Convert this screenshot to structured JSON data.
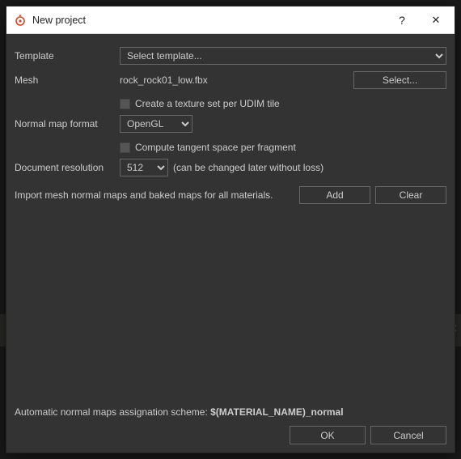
{
  "titlebar": {
    "title": "New project",
    "help_label": "?",
    "close_label": "✕"
  },
  "template": {
    "label": "Template",
    "selected": "Select template..."
  },
  "mesh": {
    "label": "Mesh",
    "filename": "rock_rock01_low.fbx",
    "select_button": "Select..."
  },
  "udim": {
    "label": "Create a texture set per UDIM tile"
  },
  "normal": {
    "label": "Normal map format",
    "selected": "OpenGL"
  },
  "tangent": {
    "label": "Compute tangent space per fragment"
  },
  "resolution": {
    "label": "Document resolution",
    "selected": "512",
    "note": "(can be changed later without loss)"
  },
  "import": {
    "text": "Import mesh normal maps and baked maps for all materials.",
    "add": "Add",
    "clear": "Clear"
  },
  "scheme": {
    "prefix": "Automatic normal maps assignation scheme: ",
    "value": "$(MATERIAL_NAME)_normal"
  },
  "buttons": {
    "ok": "OK",
    "cancel": "Cancel"
  }
}
